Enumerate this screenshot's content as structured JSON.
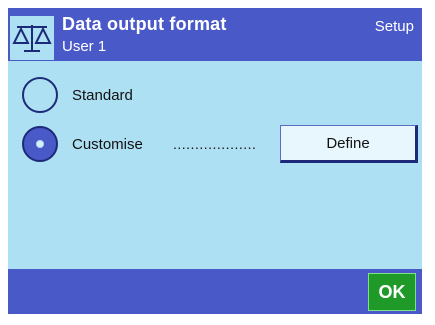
{
  "header": {
    "title": "Data output format",
    "subtitle": "User 1",
    "section": "Setup",
    "icon": "balance-scale-icon"
  },
  "options": [
    {
      "label": "Standard",
      "selected": false
    },
    {
      "label": "Customise",
      "dots": "...................",
      "selected": true
    }
  ],
  "define_button": {
    "label": "Define"
  },
  "footer": {
    "ok_label": "OK"
  },
  "colors": {
    "background": "#aee0f4",
    "header": "#4a59c8",
    "ok_button": "#1f9a28"
  }
}
